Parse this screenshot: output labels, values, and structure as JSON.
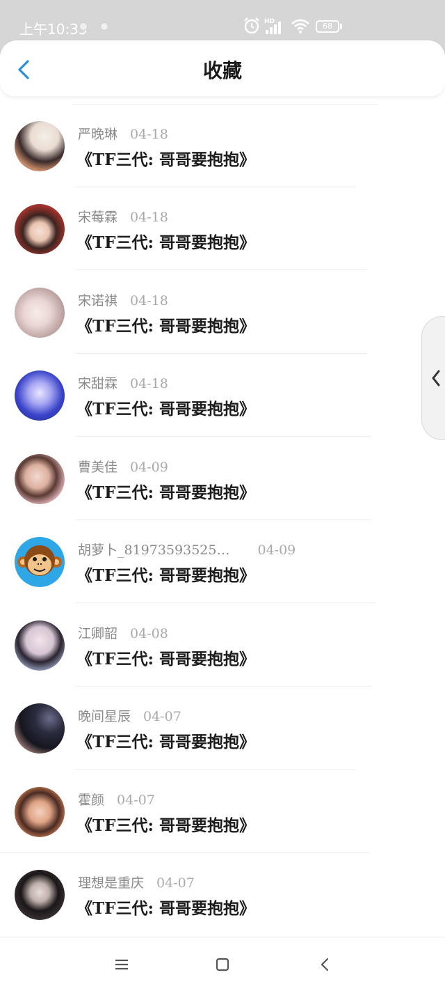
{
  "status_bar": {
    "time": "上午10:35",
    "battery": "68",
    "icons": [
      "notification-dot-icon",
      "notification-dot-icon",
      "alarm-icon",
      "hd-signal-icon",
      "wifi-icon",
      "battery-icon"
    ]
  },
  "header": {
    "title": "收藏",
    "back_icon": "chevron-left-icon"
  },
  "items": [
    {
      "author": "严晚琳",
      "date": "04-18",
      "title": "《TF三代: 哥哥要抱抱》"
    },
    {
      "author": "宋莓霖",
      "date": "04-18",
      "title": "《TF三代: 哥哥要抱抱》"
    },
    {
      "author": "宋诺祺",
      "date": "04-18",
      "title": "《TF三代: 哥哥要抱抱》"
    },
    {
      "author": "宋甜霖",
      "date": "04-18",
      "title": "《TF三代: 哥哥要抱抱》"
    },
    {
      "author": "曹美佳",
      "date": "04-09",
      "title": "《TF三代: 哥哥要抱抱》"
    },
    {
      "author": "胡萝卜_81973593525…",
      "date": "04-09",
      "title": "《TF三代: 哥哥要抱抱》"
    },
    {
      "author": "江卿韶",
      "date": "04-08",
      "title": "《TF三代: 哥哥要抱抱》"
    },
    {
      "author": "晚间星辰",
      "date": "04-07",
      "title": "《TF三代: 哥哥要抱抱》"
    },
    {
      "author": "霍颜",
      "date": "04-07",
      "title": "《TF三代: 哥哥要抱抱》"
    },
    {
      "author": "理想是重庆",
      "date": "04-07",
      "title": "《TF三代: 哥哥要抱抱》"
    }
  ],
  "side_tab": {
    "icon": "chevron-left-icon"
  },
  "nav_bar": {
    "icons": [
      "menu-icon",
      "home-square-icon",
      "back-chevron-icon"
    ]
  },
  "colors": {
    "accent": "#2a8de0",
    "status_bar": "#d6d6d6",
    "text": "#1c1c1c",
    "meta": "#8a8a8a"
  }
}
